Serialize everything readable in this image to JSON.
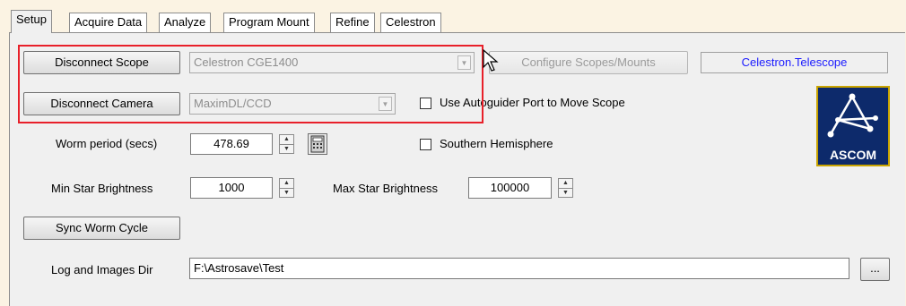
{
  "tabs": [
    "Setup",
    "Acquire Data",
    "Analyze",
    "Program Mount",
    "Refine",
    "Celestron"
  ],
  "setup": {
    "disconnect_scope_label": "Disconnect Scope",
    "disconnect_camera_label": "Disconnect Camera",
    "scope_value": "Celestron CGE1400",
    "camera_value": "MaximDL/CCD",
    "configure_scopes_label": "Configure Scopes/Mounts",
    "driver_name": "Celestron.Telescope",
    "use_autoguider_label": "Use Autoguider Port to Move Scope",
    "use_autoguider_checked": false,
    "worm_period_label": "Worm period (secs)",
    "worm_period_value": "478.69",
    "southern_hemisphere_label": "Southern Hemisphere",
    "southern_hemisphere_checked": false,
    "min_star_label": "Min Star Brightness",
    "min_star_value": "1000",
    "max_star_label": "Max Star Brightness",
    "max_star_value": "100000",
    "sync_worm_label": "Sync Worm Cycle",
    "log_dir_label": "Log and Images Dir",
    "log_dir_value": "F:\\Astrosave\\Test",
    "browse_label": "...",
    "ascom_logo_text": "ASCOM"
  },
  "colors": {
    "highlight_box": "#e8202a",
    "driver_text": "#1a1aff",
    "ascom_bg": "#0d2a6b",
    "ascom_border": "#c9a400"
  }
}
